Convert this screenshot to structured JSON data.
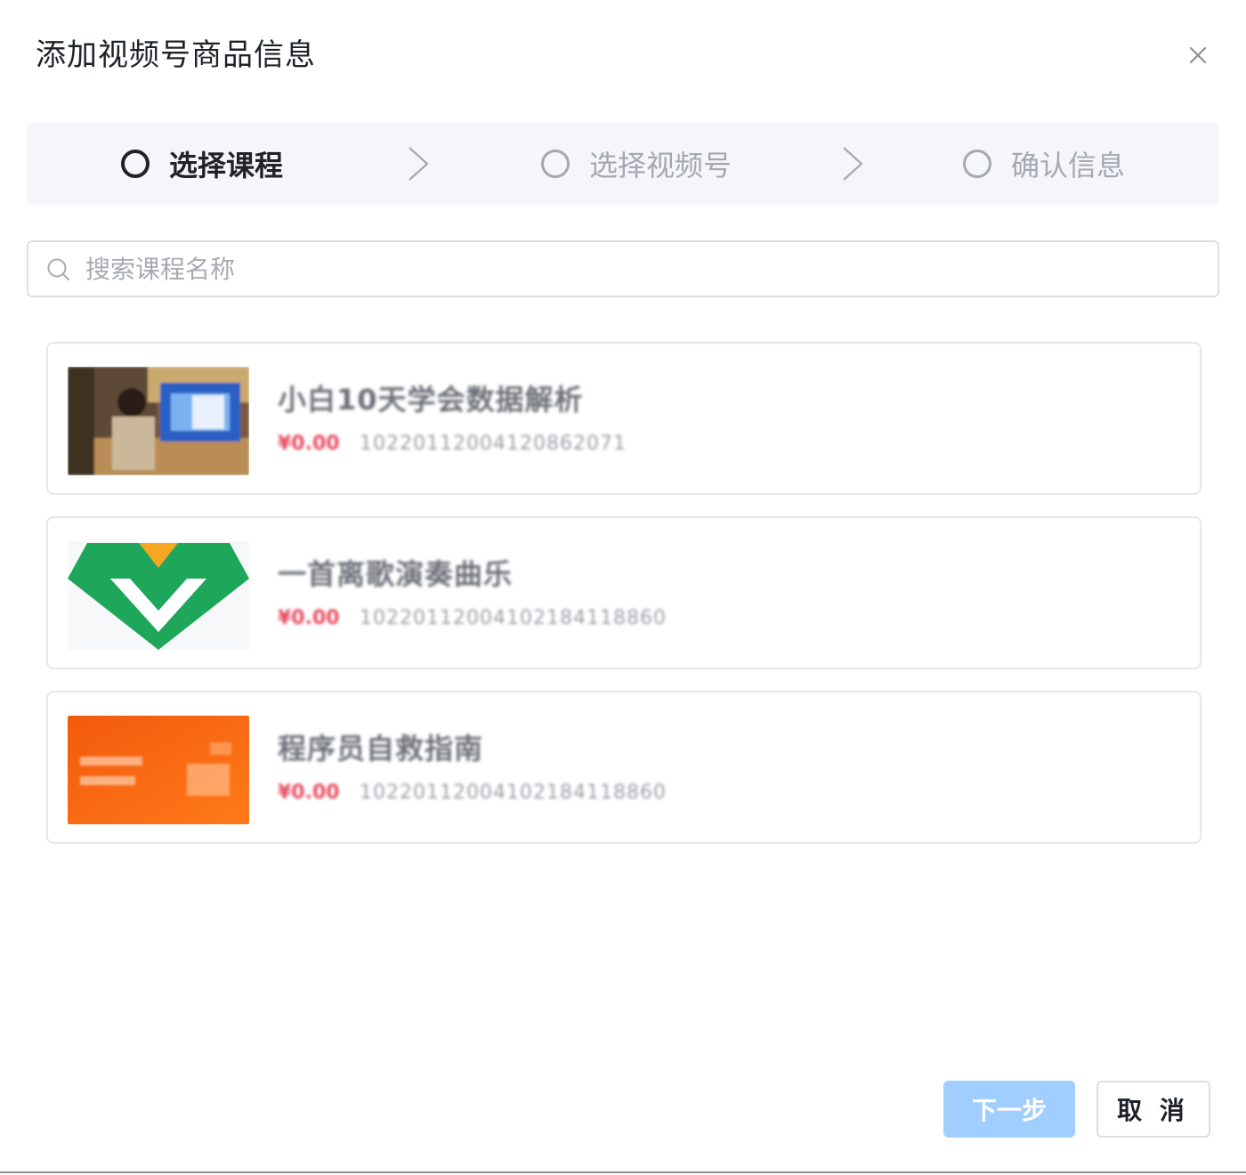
{
  "dialog": {
    "title": "添加视频号商品信息"
  },
  "steps": [
    {
      "label": "选择课程",
      "state": "active"
    },
    {
      "label": "选择视频号",
      "state": "inactive"
    },
    {
      "label": "确认信息",
      "state": "inactive"
    }
  ],
  "search": {
    "placeholder": "搜索课程名称",
    "value": ""
  },
  "courses": [
    {
      "name": "小白10天学会数据解析",
      "price": "¥0.00",
      "id": "10220112004120862071",
      "thumbnail": "photo-person-computer"
    },
    {
      "name": "一首离歌演奏曲乐",
      "price": "¥0.00",
      "id": "10220112004102184118860",
      "thumbnail": "green-v-logo"
    },
    {
      "name": "程序员自救指南",
      "price": "¥0.00",
      "id": "10220112004102184118860",
      "thumbnail": "orange-banner"
    }
  ],
  "buttons": {
    "next": "下一步",
    "cancel": "取 消"
  },
  "colors": {
    "primary_disabled": "#a0cfff",
    "price": "#e84a5f",
    "step_active": "#1f2329",
    "step_inactive": "#a3a8b1",
    "steps_bg": "#f5f6fa"
  }
}
